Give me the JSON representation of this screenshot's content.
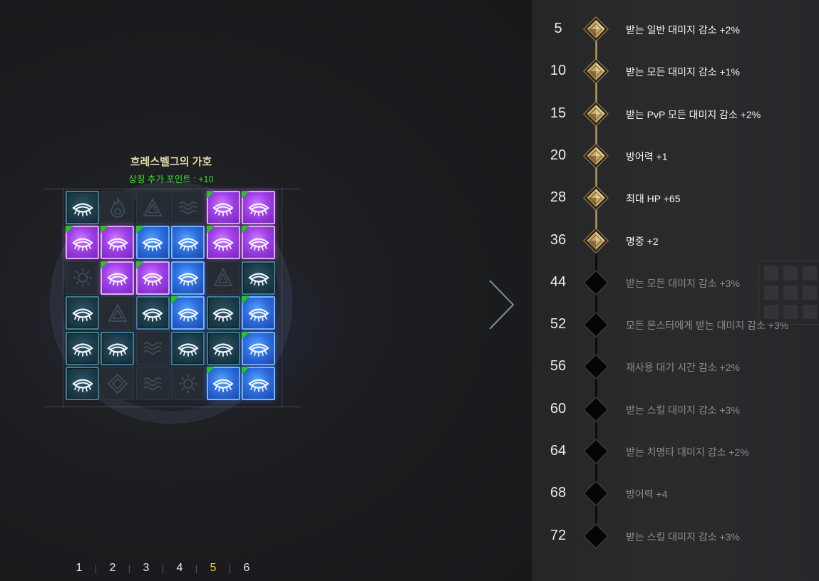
{
  "grid": {
    "title": "흐레스벨그의 가호",
    "subtitle": "상징 추가 포인트 : +10",
    "cells": [
      [
        "teal",
        "empty",
        "empty",
        "empty",
        "purple",
        "purple"
      ],
      [
        "purple",
        "purple",
        "blue",
        "blue",
        "purple",
        "purple"
      ],
      [
        "empty",
        "purple",
        "purple",
        "blue",
        "empty",
        "teal"
      ],
      [
        "teal",
        "empty",
        "teal",
        "blue",
        "teal",
        "blue"
      ],
      [
        "teal",
        "teal",
        "empty",
        "teal",
        "teal",
        "blue"
      ],
      [
        "teal",
        "empty",
        "empty",
        "empty",
        "blue",
        "blue"
      ]
    ],
    "corner_marks": [
      [
        false,
        false,
        false,
        false,
        true,
        true
      ],
      [
        true,
        true,
        true,
        false,
        true,
        true
      ],
      [
        false,
        true,
        true,
        false,
        false,
        false
      ],
      [
        false,
        false,
        false,
        true,
        false,
        true
      ],
      [
        false,
        false,
        false,
        false,
        false,
        true
      ],
      [
        false,
        false,
        false,
        false,
        true,
        true
      ]
    ],
    "empty_icons": {
      "0-1": "flame-icon",
      "0-2": "triangle-rune-icon",
      "0-3": "wave-icon",
      "2-0": "sun-icon",
      "2-4": "triangle-rune-icon",
      "3-1": "triangle-rune-icon",
      "4-2": "wave-icon",
      "5-1": "diamond-rune-icon",
      "5-2": "wave-icon",
      "5-3": "sun-icon"
    }
  },
  "pages": {
    "tabs": [
      "1",
      "2",
      "3",
      "4",
      "5",
      "6"
    ],
    "active": "5"
  },
  "colors": {
    "active_tab": "#f2c84b",
    "subtitle": "#3fd93a",
    "title": "#e4d6a8",
    "corner": "#27c51f"
  },
  "levels": [
    {
      "level": "5",
      "effect": "받는 일반 대미지 감소 +2%",
      "unlocked": true
    },
    {
      "level": "10",
      "effect": "받는 모든 대미지 감소 +1%",
      "unlocked": true
    },
    {
      "level": "15",
      "effect": "받는 PvP 모든 대미지 감소 +2%",
      "unlocked": true
    },
    {
      "level": "20",
      "effect": "방어력 +1",
      "unlocked": true
    },
    {
      "level": "28",
      "effect": "최대 HP +65",
      "unlocked": true
    },
    {
      "level": "36",
      "effect": "명중 +2",
      "unlocked": true
    },
    {
      "level": "44",
      "effect": "받는 모든 대미지 감소 +3%",
      "unlocked": false
    },
    {
      "level": "52",
      "effect": "모든 몬스터에게 받는 대미지 감소 +3%",
      "unlocked": false
    },
    {
      "level": "56",
      "effect": "재사용 대기 시간 감소 +2%",
      "unlocked": false
    },
    {
      "level": "60",
      "effect": "받는 스킬 대미지 감소 +3%",
      "unlocked": false
    },
    {
      "level": "64",
      "effect": "받는 치명타 대미지 감소 +2%",
      "unlocked": false
    },
    {
      "level": "68",
      "effect": "방어력 +4",
      "unlocked": false
    },
    {
      "level": "72",
      "effect": "받는 스킬 대미지 감소 +3%",
      "unlocked": false
    }
  ]
}
